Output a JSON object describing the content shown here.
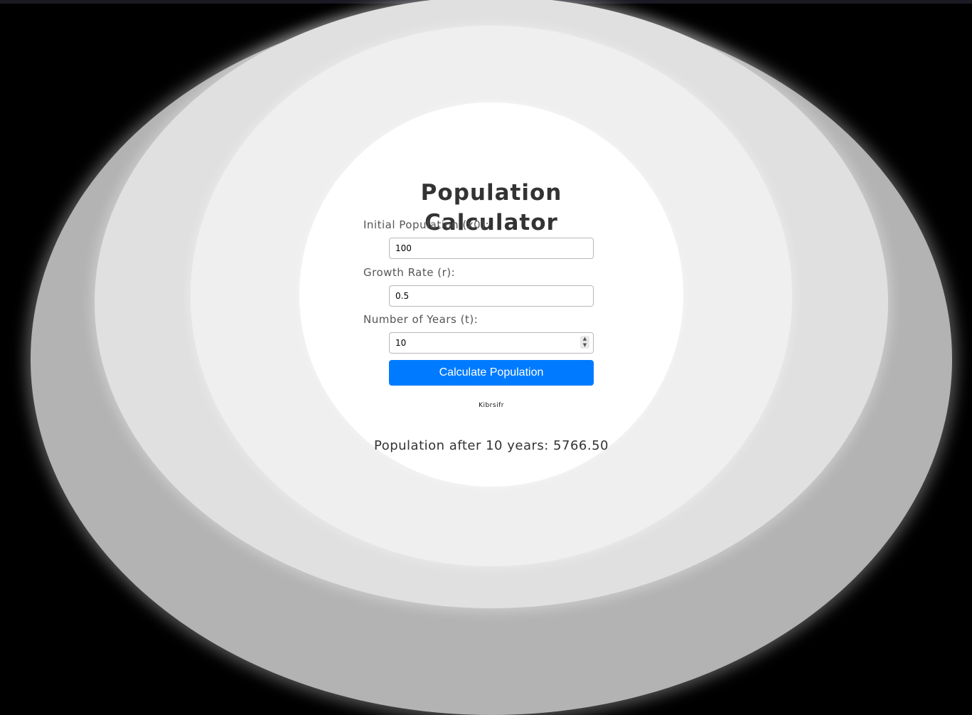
{
  "app": {
    "title": "Population Calculator"
  },
  "form": {
    "initial_population": {
      "label": "Initial Population (x0):",
      "value": "100"
    },
    "growth_rate": {
      "label": "Growth Rate (r):",
      "value": "0.5"
    },
    "years": {
      "label": "Number of Years (t):",
      "value": "10"
    },
    "submit_label": "Calculate Population"
  },
  "credit": "Kibrsifr",
  "result": {
    "text": "Population after 10 years: 5766.50"
  },
  "colors": {
    "accent": "#007bff",
    "background": "#000000",
    "card": "#ffffff"
  }
}
